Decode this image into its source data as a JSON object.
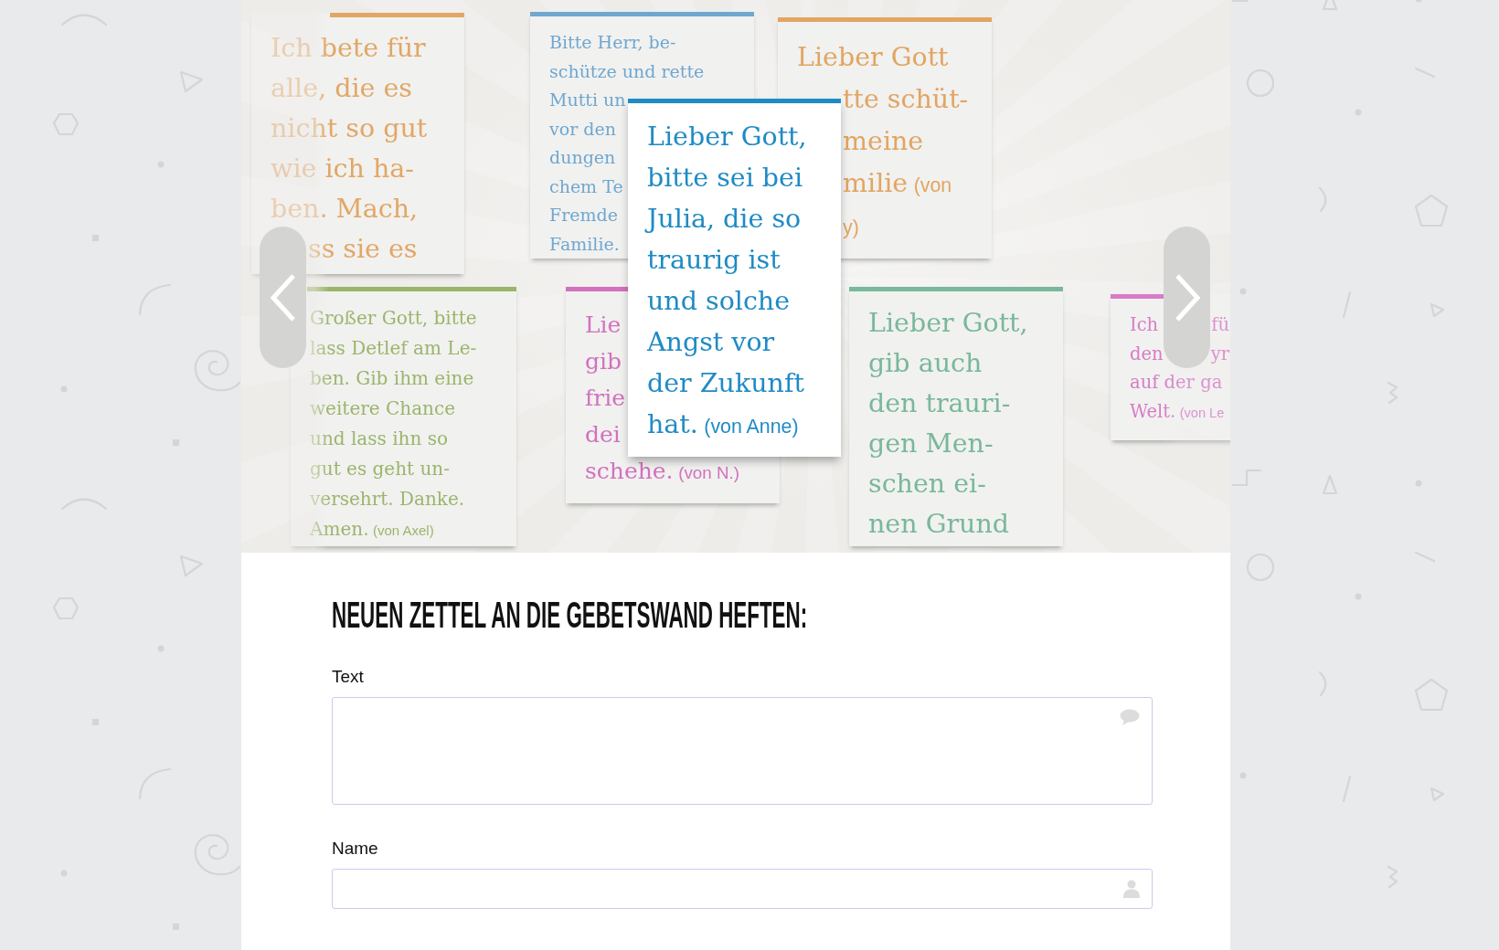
{
  "prayer_wall": {
    "notes": [
      {
        "color": "#e2a765",
        "lines": [
          {
            "text": "Ich bete für"
          },
          {
            "text": "alle, die es"
          },
          {
            "text": "nicht so gut"
          },
          {
            "text": "wie ich ha-"
          },
          {
            "text": "ben. Mach,"
          },
          {
            "text": "ss sie es"
          }
        ]
      },
      {
        "color": "#6fa7d0",
        "lines": [
          {
            "text": "Bitte Herr, be-"
          },
          {
            "text": "schütze und rette"
          },
          {
            "text": "Mutti un"
          },
          {
            "text": "vor den"
          },
          {
            "text": "dungen"
          },
          {
            "text": "chem Te"
          },
          {
            "text": "Fremde"
          },
          {
            "text": "Familie."
          }
        ]
      },
      {
        "color": "#e2a562",
        "lines": [
          {
            "text": "Lieber Gott"
          },
          {
            "text": "tte schüt-"
          },
          {
            "text": "meine"
          },
          {
            "text": "milie",
            "author": "(von"
          },
          {
            "author": "y)"
          }
        ]
      },
      {
        "color": "#9bb56a",
        "lines": [
          {
            "text": "Großer Gott, bitte"
          },
          {
            "text": "lass Detlef am Le-"
          },
          {
            "text": "ben. Gib ihm eine"
          },
          {
            "text": "weitere Chance"
          },
          {
            "text": "und lass ihn so"
          },
          {
            "text": "gut es geht un-"
          },
          {
            "text": "versehrt. Danke."
          },
          {
            "text": "Amen.",
            "author": "(von Axel)"
          }
        ]
      },
      {
        "color": "#d271be",
        "lines": [
          {
            "text": "Lie"
          },
          {
            "text": "gib"
          },
          {
            "text": "frie"
          },
          {
            "text": "dei"
          },
          {
            "text": "schehe.",
            "author": "(von N.)"
          }
        ]
      },
      {
        "color": "#79b89a",
        "lines": [
          {
            "text": "Lieber Gott,"
          },
          {
            "text": "gib auch"
          },
          {
            "text": "den trauri-"
          },
          {
            "text": "gen Men-"
          },
          {
            "text": "schen ei-"
          },
          {
            "text": "nen Grund"
          }
        ]
      },
      {
        "color": "#d77cc6",
        "lines": [
          {
            "text": "Ich",
            "tail": "fü"
          },
          {
            "text": "den",
            "tail": "yr"
          },
          {
            "text": "auf der ga"
          },
          {
            "text": "Welt.",
            "author": "(von Le"
          }
        ]
      }
    ],
    "open_note": {
      "color": "#1f8bc4",
      "lines": [
        {
          "text": "Lieber Gott,"
        },
        {
          "text": "bitte sei bei"
        },
        {
          "text": "Julia, die so"
        },
        {
          "text": "traurig ist"
        },
        {
          "text": "und solche"
        },
        {
          "text": "Angst vor"
        },
        {
          "text": "der Zukunft"
        },
        {
          "text": "hat.",
          "author": "(von Anne)"
        }
      ]
    }
  },
  "form": {
    "title": "NEUEN ZETTEL AN DIE GEBETSWAND HEFTEN:",
    "fields": [
      {
        "label": "Text",
        "kind": "textarea"
      },
      {
        "label": "Name",
        "kind": "text"
      }
    ]
  }
}
